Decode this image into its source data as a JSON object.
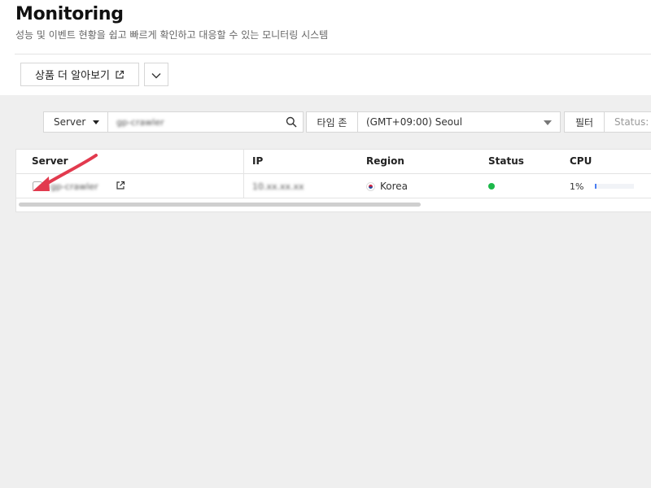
{
  "header": {
    "title": "Monitoring",
    "subtitle": "성능 및 이벤트 현황을 쉽고 빠르게 확인하고 대응할 수 있는 모니터링 시스템",
    "learn_more": "상품 더 알아보기"
  },
  "filters": {
    "field_select": "Server",
    "search_value": "gp-crawler",
    "timezone_label": "타임 존",
    "timezone_value": "(GMT+09:00) Seoul",
    "filter_button": "필터",
    "status_label": "Status: -"
  },
  "table": {
    "columns": [
      "Server",
      "IP",
      "Region",
      "Status",
      "CPU"
    ],
    "rows": [
      {
        "server": "gp-crawler",
        "ip": "10.xx.xx.xx",
        "region": "Korea",
        "status": "running",
        "cpu_label": "1%",
        "cpu_percent": 1
      }
    ]
  },
  "colors": {
    "status_ok": "#1cb84a",
    "cpu_bar": "#4a7df2",
    "annotation": "#e23a4e"
  },
  "icons": [
    "external-link-icon",
    "chevron-down-icon",
    "search-icon",
    "korea-flag-icon",
    "arrow-annotation"
  ]
}
